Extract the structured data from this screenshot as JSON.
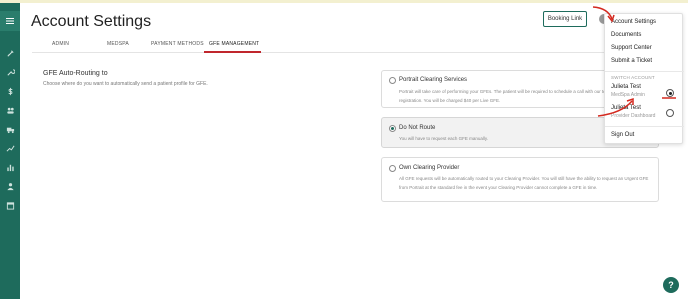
{
  "colors": {
    "sidebar": "#1e6b5c",
    "accent": "#c0262d",
    "primary": "#1e6b5c"
  },
  "sidebar": {
    "menu_icon": "hamburger-icon",
    "icons": [
      "syringe-icon",
      "wrench-icon",
      "dollar-icon",
      "users-group-icon",
      "truck-icon",
      "trend-line-icon",
      "bar-chart-icon",
      "people-icon",
      "calendar-icon"
    ]
  },
  "header": {
    "title": "Account Settings",
    "booking_link_label": "Booking Link"
  },
  "tabs": [
    {
      "label": "ADMIN",
      "active": false
    },
    {
      "label": "MEDSPA",
      "active": false
    },
    {
      "label": "PAYMENT METHODS",
      "active": false
    },
    {
      "label": "GFE MANAGEMENT",
      "active": true
    }
  ],
  "section": {
    "title": "GFE Auto-Routing to",
    "description": "Choose where do you want to automatically send a patient profile for GFE."
  },
  "options": [
    {
      "title": "Portrait Clearing Services",
      "description": "Portrait will take care of performing your GFEs. The patient will be required to schedule a call with our team upon registration. You will be charged $40 per Live GFE.",
      "selected": false
    },
    {
      "title": "Do Not Route",
      "description": "You will have to request each GFE manually.",
      "selected": true
    },
    {
      "title": "Own Clearing Provider",
      "description": "All GFE requests will be automatically routed to your Clearing Provider. You will still have the ability to request an Urgent GFE from Portrait at the standard fee in the event your Clearing Provider cannot complete a GFE in time.",
      "selected": false
    }
  ],
  "dropdown": {
    "items": [
      "Account Settings",
      "Documents",
      "Support Center",
      "Submit a Ticket"
    ],
    "switch_header": "SWITCH ACCOUNT",
    "accounts": [
      {
        "name": "Julieta Test",
        "role": "MedSpa Admin",
        "selected": true
      },
      {
        "name": "Julieta Test",
        "role": "Provider Dashboard",
        "selected": false
      }
    ],
    "sign_out": "Sign Out"
  },
  "help_label": "?"
}
